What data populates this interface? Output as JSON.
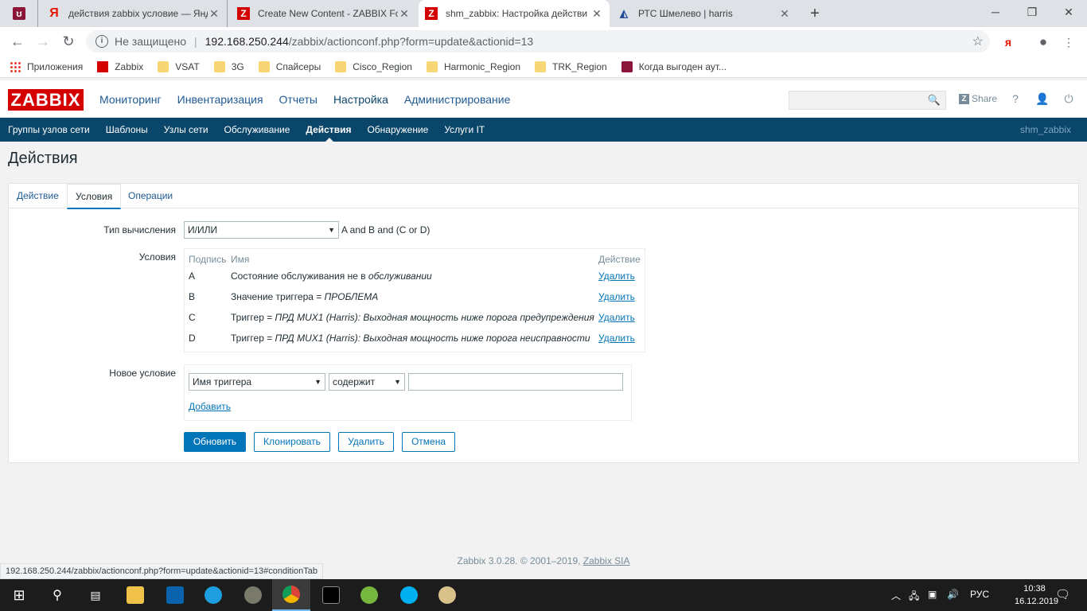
{
  "browser": {
    "tabs": [
      {
        "title": "",
        "favicon": "mikrotik-icon"
      },
      {
        "title": "действия zabbix условие — Янд",
        "favicon": "yandex-icon"
      },
      {
        "title": "Create New Content - ZABBIX Fo",
        "favicon": "zabbix-icon"
      },
      {
        "title": "shm_zabbix: Настройка действи",
        "favicon": "zabbix-icon"
      },
      {
        "title": "РТС Шмелево | harris",
        "favicon": "harris-icon"
      }
    ],
    "insecure_label": "Не защищено",
    "url_host": "192.168.250.244",
    "url_path": "/zabbix/actionconf.php?form=update&actionid=13",
    "bookmarks": [
      "Приложения",
      "Zabbix",
      "VSAT",
      "3G",
      "Спайсеры",
      "Cisco_Region",
      "Harmonic_Region",
      "TRK_Region",
      "Когда выгоден аут..."
    ]
  },
  "zabbix": {
    "logo": "ZABBIX",
    "top_menu": [
      "Мониторинг",
      "Инвентаризация",
      "Отчеты",
      "Настройка",
      "Администрирование"
    ],
    "share": "Share",
    "sub_menu": [
      "Группы узлов сети",
      "Шаблоны",
      "Узлы сети",
      "Обслуживание",
      "Действия",
      "Обнаружение",
      "Услуги IT"
    ],
    "user": "shm_zabbix"
  },
  "page": {
    "title": "Действия",
    "tabs": [
      "Действие",
      "Условия",
      "Операции"
    ],
    "calc_label": "Тип вычисления",
    "calc_value": "И/ИЛИ",
    "calc_formula": "A and B and (C or D)",
    "conditions_label": "Условия",
    "conditions_header": {
      "label": "Подпись",
      "name": "Имя",
      "action": "Действие"
    },
    "conditions": [
      {
        "label": "A",
        "name_prefix": "Состояние обслуживания не в ",
        "name_value": "обслуживании",
        "action": "Удалить"
      },
      {
        "label": "B",
        "name_prefix": "Значение триггера = ",
        "name_value": "ПРОБЛЕМА",
        "action": "Удалить"
      },
      {
        "label": "C",
        "name_prefix": "Триггер = ",
        "name_value": "ПРД MUX1 (Harris): Выходная мощность ниже порога предупреждения",
        "action": "Удалить"
      },
      {
        "label": "D",
        "name_prefix": "Триггер = ",
        "name_value": "ПРД MUX1 (Harris): Выходная мощность ниже порога неисправности",
        "action": "Удалить"
      }
    ],
    "new_condition_label": "Новое условие",
    "new_condition_type": "Имя триггера",
    "new_condition_operator": "содержит",
    "new_condition_value": "",
    "add_link": "Добавить",
    "buttons": {
      "update": "Обновить",
      "clone": "Клонировать",
      "delete": "Удалить",
      "cancel": "Отмена"
    }
  },
  "footer": {
    "text": "Zabbix 3.0.28. © 2001–2019, ",
    "link": "Zabbix SIA"
  },
  "status_url": "192.168.250.244/zabbix/actionconf.php?form=update&actionid=13#conditionTab",
  "taskbar": {
    "lang": "РУС",
    "time": "10:38",
    "date": "16.12.2019"
  }
}
